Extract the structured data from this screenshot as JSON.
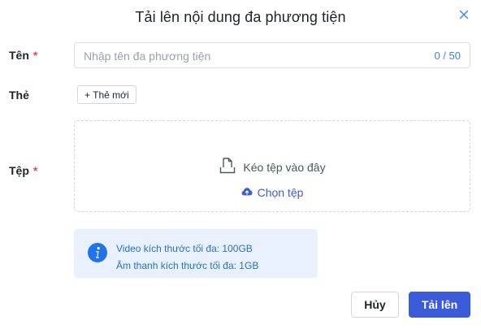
{
  "dialog": {
    "title": "Tải lên nội dung đa phương tiện",
    "close_icon": "close-icon"
  },
  "fields": {
    "name": {
      "label": "Tên",
      "required_mark": "*",
      "placeholder": "Nhập tên đa phương tiện",
      "counter": "0 / 50"
    },
    "tags": {
      "label": "Thẻ",
      "new_tag_button": "+ Thẻ mới"
    },
    "file": {
      "label": "Tệp",
      "required_mark": "*",
      "drop_text": "Kéo tệp vào đây",
      "choose_text": "Chọn tệp"
    }
  },
  "info": {
    "line1": "Video kích thước tối đa: 100GB",
    "line2": "Âm thanh kích thước tối đa: 1GB"
  },
  "footer": {
    "cancel_label": "Hủy",
    "upload_label": "Tải lên"
  },
  "colors": {
    "accent": "#3b5bdb",
    "required": "#e5484d",
    "info_bg": "#e8f1fd",
    "info_text": "#2a6fc9"
  }
}
